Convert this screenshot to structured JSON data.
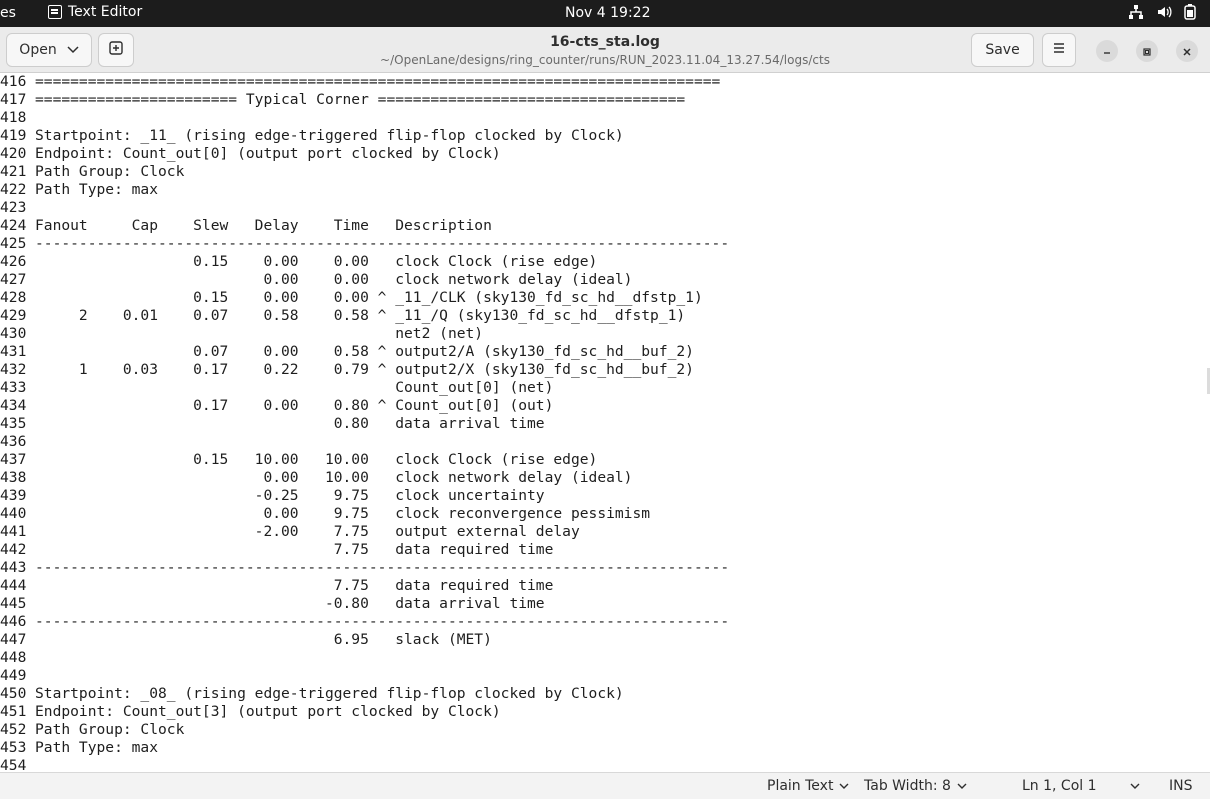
{
  "topbar": {
    "activities_label": "es",
    "app_name": "Text Editor",
    "clock": "Nov 4  19:22"
  },
  "headerbar": {
    "open_label": "Open",
    "title": "16-cts_sta.log",
    "subtitle": "~/OpenLane/designs/ring_counter/runs/RUN_2023.11.04_13.27.54/logs/cts",
    "save_label": "Save"
  },
  "editor": {
    "lines": [
      {
        "n": "416",
        "t": "=============================================================================="
      },
      {
        "n": "417",
        "t": "======================= Typical Corner ==================================="
      },
      {
        "n": "418",
        "t": ""
      },
      {
        "n": "419",
        "t": "Startpoint: _11_ (rising edge-triggered flip-flop clocked by Clock)"
      },
      {
        "n": "420",
        "t": "Endpoint: Count_out[0] (output port clocked by Clock)"
      },
      {
        "n": "421",
        "t": "Path Group: Clock"
      },
      {
        "n": "422",
        "t": "Path Type: max"
      },
      {
        "n": "423",
        "t": ""
      },
      {
        "n": "424",
        "t": "Fanout     Cap    Slew   Delay    Time   Description"
      },
      {
        "n": "425",
        "t": "-------------------------------------------------------------------------------"
      },
      {
        "n": "426",
        "t": "                  0.15    0.00    0.00   clock Clock (rise edge)"
      },
      {
        "n": "427",
        "t": "                          0.00    0.00   clock network delay (ideal)"
      },
      {
        "n": "428",
        "t": "                  0.15    0.00    0.00 ^ _11_/CLK (sky130_fd_sc_hd__dfstp_1)"
      },
      {
        "n": "429",
        "t": "     2    0.01    0.07    0.58    0.58 ^ _11_/Q (sky130_fd_sc_hd__dfstp_1)"
      },
      {
        "n": "430",
        "t": "                                         net2 (net)"
      },
      {
        "n": "431",
        "t": "                  0.07    0.00    0.58 ^ output2/A (sky130_fd_sc_hd__buf_2)"
      },
      {
        "n": "432",
        "t": "     1    0.03    0.17    0.22    0.79 ^ output2/X (sky130_fd_sc_hd__buf_2)"
      },
      {
        "n": "433",
        "t": "                                         Count_out[0] (net)"
      },
      {
        "n": "434",
        "t": "                  0.17    0.00    0.80 ^ Count_out[0] (out)"
      },
      {
        "n": "435",
        "t": "                                  0.80   data arrival time"
      },
      {
        "n": "436",
        "t": ""
      },
      {
        "n": "437",
        "t": "                  0.15   10.00   10.00   clock Clock (rise edge)"
      },
      {
        "n": "438",
        "t": "                          0.00   10.00   clock network delay (ideal)"
      },
      {
        "n": "439",
        "t": "                         -0.25    9.75   clock uncertainty"
      },
      {
        "n": "440",
        "t": "                          0.00    9.75   clock reconvergence pessimism"
      },
      {
        "n": "441",
        "t": "                         -2.00    7.75   output external delay"
      },
      {
        "n": "442",
        "t": "                                  7.75   data required time"
      },
      {
        "n": "443",
        "t": "-------------------------------------------------------------------------------"
      },
      {
        "n": "444",
        "t": "                                  7.75   data required time"
      },
      {
        "n": "445",
        "t": "                                 -0.80   data arrival time"
      },
      {
        "n": "446",
        "t": "-------------------------------------------------------------------------------"
      },
      {
        "n": "447",
        "t": "                                  6.95   slack (MET)"
      },
      {
        "n": "448",
        "t": ""
      },
      {
        "n": "449",
        "t": ""
      },
      {
        "n": "450",
        "t": "Startpoint: _08_ (rising edge-triggered flip-flop clocked by Clock)"
      },
      {
        "n": "451",
        "t": "Endpoint: Count_out[3] (output port clocked by Clock)"
      },
      {
        "n": "452",
        "t": "Path Group: Clock"
      },
      {
        "n": "453",
        "t": "Path Type: max"
      },
      {
        "n": "454",
        "t": ""
      }
    ]
  },
  "statusbar": {
    "language": "Plain Text",
    "tab_width": "Tab Width: 8",
    "position": "Ln 1, Col 1",
    "mode": "INS"
  }
}
